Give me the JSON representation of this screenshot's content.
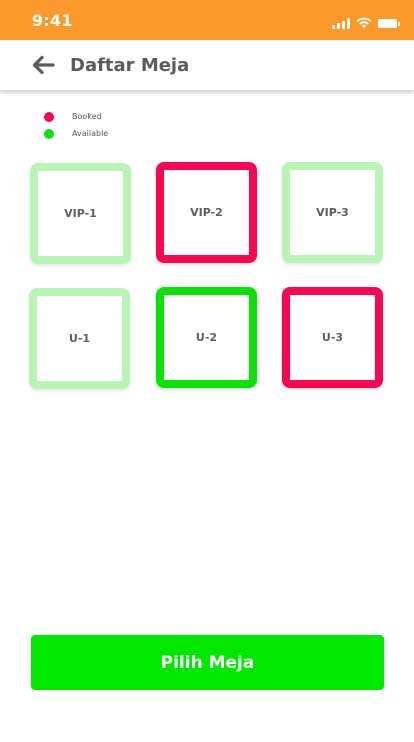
{
  "status_bar": {
    "time": "9:41",
    "background": "#fb9a2b",
    "icons": [
      "signal-icon",
      "wifi-icon",
      "battery-icon"
    ]
  },
  "header": {
    "back_icon": "back-arrow-icon",
    "title": "Daftar Meja"
  },
  "legend": [
    {
      "label": "Booked",
      "color": "#fa0650"
    },
    {
      "label": "Available",
      "color": "#07e207"
    }
  ],
  "tables": [
    {
      "label": "VIP-1",
      "status": "available",
      "color": "#b9f5b2"
    },
    {
      "label": "VIP-2",
      "status": "booked",
      "color": "#fa0650"
    },
    {
      "label": "VIP-3",
      "status": "available",
      "color": "#b9f5b2"
    },
    {
      "label": "U-1",
      "status": "available",
      "color": "#b9f5b2"
    },
    {
      "label": "U-2",
      "status": "available",
      "color": "#07e207"
    },
    {
      "label": "U-3",
      "status": "booked",
      "color": "#fa0650"
    }
  ],
  "actions": {
    "submit_label": "Pilih Meja",
    "submit_color": "#00e800"
  }
}
